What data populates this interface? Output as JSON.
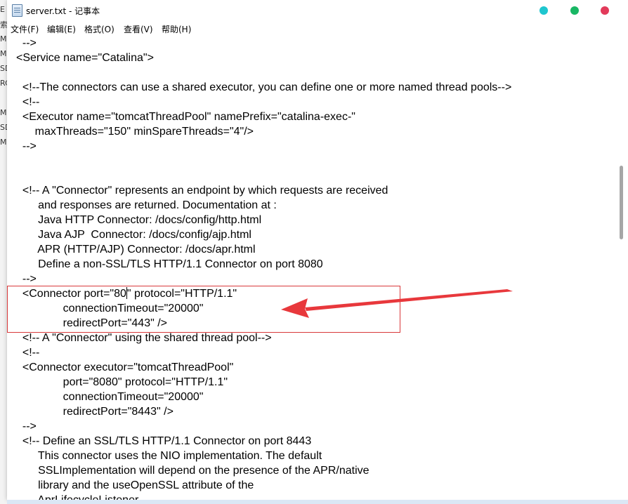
{
  "background_window": {
    "fragments": [
      "E",
      "索",
      "M",
      "M",
      "SD",
      "SD",
      "RC",
      "M",
      "M",
      "SD",
      "M"
    ]
  },
  "window": {
    "title": "server.txt - 记事本",
    "controls": [
      {
        "name": "minimize",
        "color": "#1ec6cf"
      },
      {
        "name": "maximize",
        "color": "#18b764"
      },
      {
        "name": "close",
        "color": "#e23a5a"
      }
    ]
  },
  "menu": {
    "items": [
      "文件(F)",
      "编辑(E)",
      "格式(O)",
      "查看(V)",
      "帮助(H)"
    ]
  },
  "editor": {
    "lines": [
      "  -->",
      "<Service name=\"Catalina\">",
      "",
      "  <!--The connectors can use a shared executor, you can define one or more named thread pools-->",
      "  <!--",
      "  <Executor name=\"tomcatThreadPool\" namePrefix=\"catalina-exec-\"",
      "      maxThreads=\"150\" minSpareThreads=\"4\"/>",
      "  -->",
      "",
      "",
      "  <!-- A \"Connector\" represents an endpoint by which requests are received",
      "       and responses are returned. Documentation at :",
      "       Java HTTP Connector: /docs/config/http.html",
      "       Java AJP  Connector: /docs/config/ajp.html",
      "       APR (HTTP/AJP) Connector: /docs/apr.html",
      "       Define a non-SSL/TLS HTTP/1.1 Connector on port 8080",
      "  -->",
      "  <Connector port=\"80",
      "               connectionTimeout=\"20000\"",
      "               redirectPort=\"443\" />",
      "  <!-- A \"Connector\" using the shared thread pool-->",
      "  <!--",
      "  <Connector executor=\"tomcatThreadPool\"",
      "               port=\"8080\" protocol=\"HTTP/1.1\"",
      "               connectionTimeout=\"20000\"",
      "               redirectPort=\"8443\" />",
      "  -->",
      "  <!-- Define an SSL/TLS HTTP/1.1 Connector on port 8443",
      "       This connector uses the NIO implementation. The default",
      "       SSLImplementation will depend on the presence of the APR/native",
      "       library and the useOpenSSL attribute of the",
      "       AprLifecycleListener."
    ],
    "caret_line_tail": "\" protocol=\"HTTP/1.1\""
  },
  "annotation": {
    "box_color": "#d9383a",
    "arrow_color": "#e8383c"
  }
}
